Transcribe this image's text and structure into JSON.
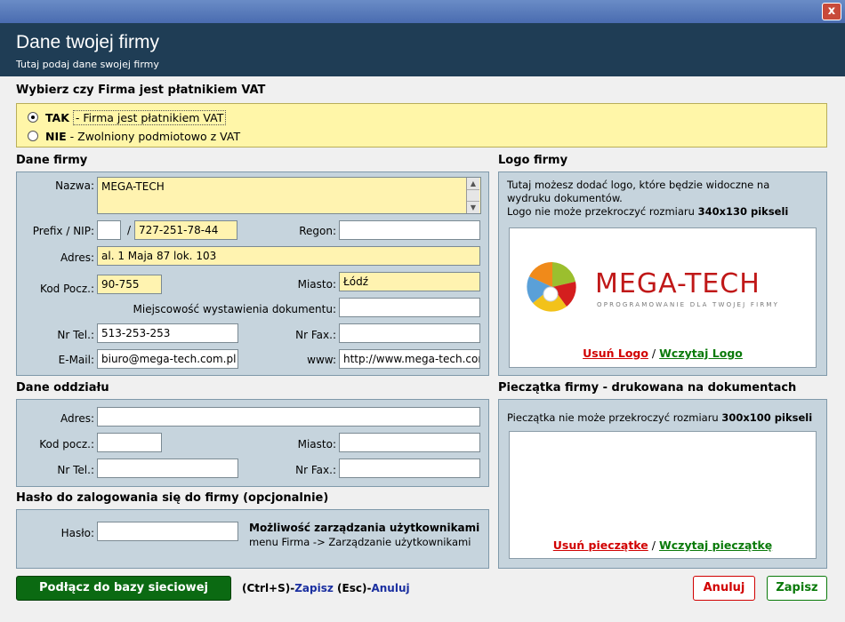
{
  "window": {
    "close_label": "x"
  },
  "header": {
    "title": "Dane twojej firmy",
    "subtitle": "Tutaj podaj dane swojej firmy"
  },
  "vat": {
    "title": "Wybierz czy Firma jest płatnikiem VAT",
    "options": [
      {
        "key": "TAK",
        "text": "- Firma jest płatnikiem VAT",
        "selected": true
      },
      {
        "key": "NIE",
        "text": "- Zwolniony podmiotowo z VAT",
        "selected": false
      }
    ]
  },
  "company": {
    "title": "Dane firmy",
    "name_label": "Nazwa:",
    "name_value": "MEGA-TECH",
    "prefix_label": "Prefix / NIP:",
    "prefix_value": "",
    "nip_sep": "/",
    "nip_value": "727-251-78-44",
    "regon_label": "Regon:",
    "regon_value": "",
    "address_label": "Adres:",
    "address_value": "al. 1 Maja 87 lok. 103",
    "postal_label": "Kod Pocz.:",
    "postal_value": "90-755",
    "city_label": "Miasto:",
    "city_value": "Łódź",
    "issue_place_label": "Miejscowość wystawienia dokumentu:",
    "issue_place_value": "",
    "phone_label": "Nr Tel.:",
    "phone_value": "513-253-253",
    "fax_label": "Nr Fax.:",
    "fax_value": "",
    "email_label": "E-Mail:",
    "email_value": "biuro@mega-tech.com.pl",
    "www_label": "www:",
    "www_value": "http://www.mega-tech.com"
  },
  "branch": {
    "title": "Dane oddziału",
    "address_label": "Adres:",
    "address_value": "",
    "postal_label": "Kod pocz.:",
    "postal_value": "",
    "city_label": "Miasto:",
    "city_value": "",
    "phone_label": "Nr Tel.:",
    "phone_value": "",
    "fax_label": "Nr Fax.:",
    "fax_value": ""
  },
  "password": {
    "title": "Hasło do zalogowania się do firmy (opcjonalnie)",
    "label": "Hasło:",
    "value": "",
    "users_title": "Możliwość zarządzania użytkownikami",
    "users_hint": "menu Firma -> Zarządzanie użytkownikami"
  },
  "logo": {
    "title": "Logo firmy",
    "info_line1": "Tutaj możesz dodać logo, które będzie widoczne na",
    "info_line2": "wydruku dokumentów.",
    "info_line3_prefix": "Logo nie może przekroczyć rozmiaru",
    "info_size": "340x130 pikseli",
    "brand_text": "MEGA-TECH",
    "brand_tagline": "OPROGRAMOWANIE DLA TWOJEJ FIRMY",
    "remove_label": "Usuń Logo",
    "separator": "/",
    "load_label": "Wczytaj Logo"
  },
  "stamp": {
    "title": "Pieczątka firmy - drukowana na dokumentach",
    "info_prefix": "Pieczątka nie może przekroczyć rozmiaru",
    "info_size": "300x100 pikseli",
    "remove_label": "Usuń pieczątke",
    "separator": "/",
    "load_label": "Wczytaj pieczątkę"
  },
  "footer": {
    "network_button": "Podłącz do bazy sieciowej",
    "shortcut_save_key": "(Ctrl+S)-",
    "shortcut_save_label": "Zapisz",
    "shortcut_cancel_key": " (Esc)-",
    "shortcut_cancel_label": "Anuluj",
    "cancel_button": "Anuluj",
    "save_button": "Zapisz"
  },
  "colors": {
    "header_bg": "#1f3d55",
    "vat_bg": "#fff6a8",
    "panel_bg": "#c6d4dd",
    "network_btn_bg": "#0b6a12",
    "cancel_red": "#d10000",
    "save_green": "#0a7a0a"
  }
}
